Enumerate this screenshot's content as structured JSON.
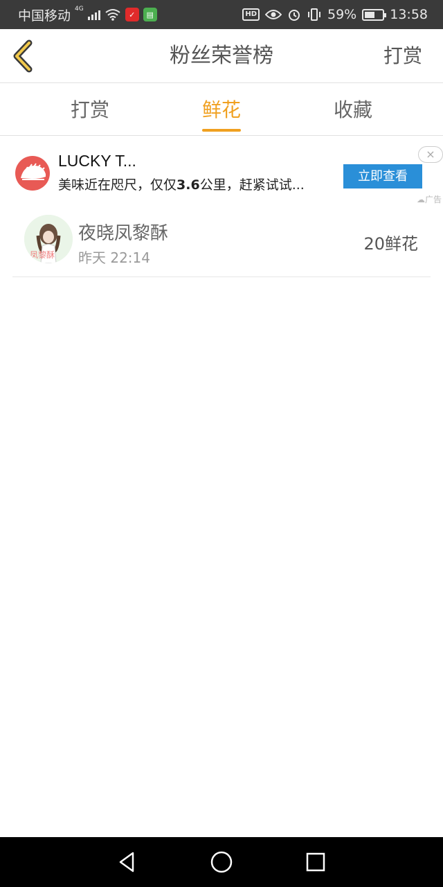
{
  "status_bar": {
    "carrier": "中国移动",
    "network": "4G",
    "battery_percent": "59%",
    "battery_level": 0.59,
    "time": "13:58",
    "hd": "HD",
    "icons": [
      "signal-icon",
      "wifi-icon",
      "app-notification-icon",
      "app-notification-icon",
      "eye-icon",
      "alarm-icon",
      "vibrate-icon",
      "battery-icon"
    ]
  },
  "header": {
    "back_icon": "chevron-left-icon",
    "title": "粉丝荣誉榜",
    "action_label": "打赏"
  },
  "tabs": [
    {
      "label": "打赏",
      "active": false
    },
    {
      "label": "鲜花",
      "active": true
    },
    {
      "label": "收藏",
      "active": false
    }
  ],
  "ad": {
    "title": "LUCKY T...",
    "description_prefix": "美味近在咫尺，仅仅",
    "description_distance": "3.6",
    "description_suffix": "公里，赶紧试试...",
    "button_label": "立即查看",
    "close_label": "×",
    "ad_tag": "广告"
  },
  "fans": [
    {
      "name": "夜晓凤黎酥",
      "time": "昨天 22:14",
      "count": "20鲜花"
    }
  ],
  "colors": {
    "accent": "#f0a020",
    "ad_button": "#2a8fd8",
    "status_bar_bg": "#3a3a3a"
  },
  "nav_bar": {
    "buttons": [
      "back-triangle-icon",
      "home-circle-icon",
      "recents-square-icon"
    ]
  }
}
